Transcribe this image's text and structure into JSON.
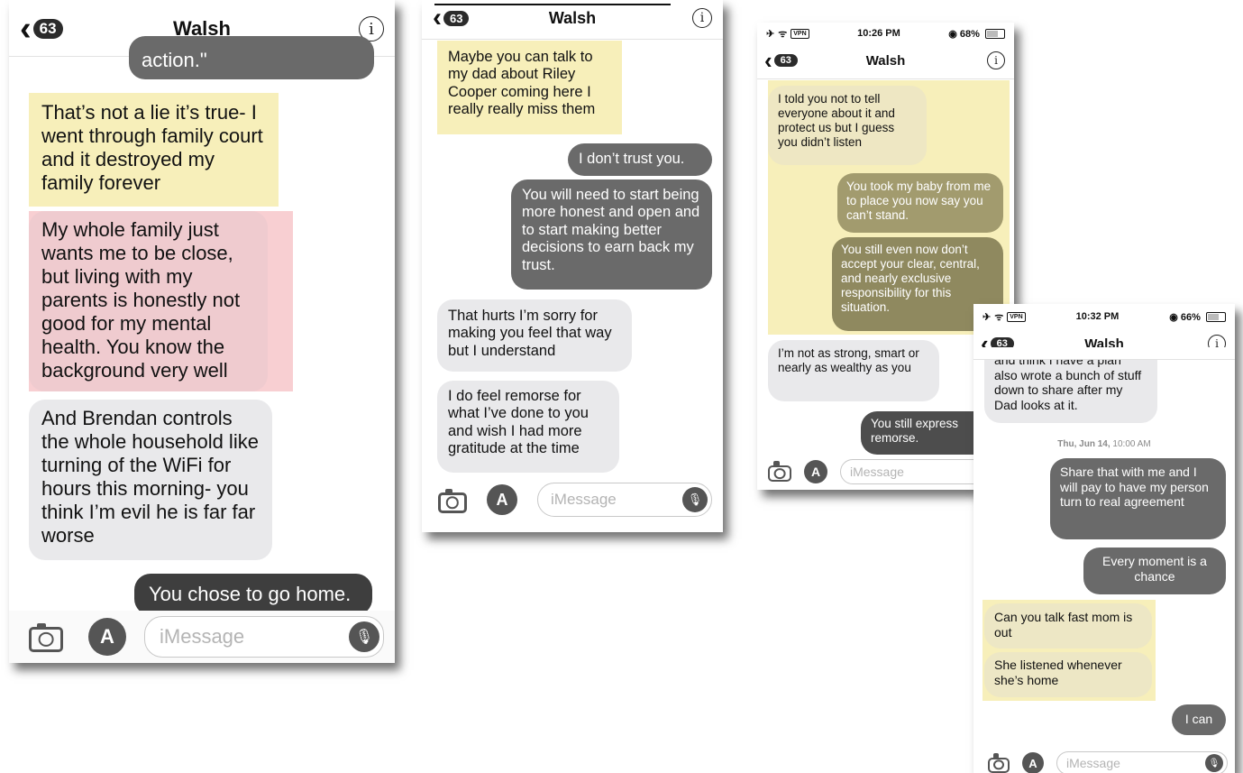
{
  "screens": [
    {
      "contact": "Walsh",
      "unread_count": "63",
      "messages": [
        {
          "dir": "out",
          "text": "action.\""
        },
        {
          "dir": "in",
          "text": "That’s not a lie it’s true- I went through family court and it destroyed my family forever"
        },
        {
          "dir": "in",
          "text": "My whole family just wants me to be close, but living with my parents is honestly not good for my mental health. You know the background very well"
        },
        {
          "dir": "in",
          "text": "And Brendan controls the whole household like turning of the WiFi for hours this morning- you think I’m evil he is far far worse"
        },
        {
          "dir": "out",
          "text": "You chose to go home."
        }
      ],
      "input_placeholder": "iMessage"
    },
    {
      "contact": "Walsh",
      "unread_count": "63",
      "messages": [
        {
          "dir": "in",
          "text": "Maybe you can talk to my dad about Riley Cooper coming here I really really miss them"
        },
        {
          "dir": "out",
          "text": "I don’t trust you."
        },
        {
          "dir": "out",
          "text": "You will need to start being more honest and open and to start making better decisions to earn back my trust."
        },
        {
          "dir": "in",
          "text": "That hurts I’m sorry for making you feel that way but I understand"
        },
        {
          "dir": "in",
          "text": "I do feel remorse for what I’ve done to you and wish I had more gratitude at the time"
        }
      ],
      "input_placeholder": "iMessage"
    },
    {
      "status_time": "10:26 PM",
      "status_battery": "68%",
      "contact": "Walsh",
      "unread_count": "63",
      "messages": [
        {
          "dir": "in",
          "text": "I told you not to tell everyone about it and protect us but I guess you didn’t listen"
        },
        {
          "dir": "out",
          "text": "You took my baby from me to place you now say you can’t stand."
        },
        {
          "dir": "out",
          "text": "You still even now don’t accept your clear, central, and nearly exclusive responsibility for this situation."
        },
        {
          "dir": "in",
          "text": "I’m not as strong, smart or nearly as wealthy as you"
        },
        {
          "dir": "out",
          "text": "You still express remorse."
        }
      ],
      "input_placeholder": "iMessage"
    },
    {
      "status_time": "10:32 PM",
      "status_battery": "66%",
      "contact": "Walsh",
      "unread_count": "63",
      "timestamp_day": "Thu, Jun 14,",
      "timestamp_time": "10:00 AM",
      "messages": [
        {
          "dir": "in",
          "text": "and think I have a plan also wrote a bunch of stuff down to share after my Dad looks at it."
        },
        {
          "dir": "out",
          "text": "Share that with me and I will pay to have my person turn to real agreement"
        },
        {
          "dir": "out",
          "text": "Every moment is a chance"
        },
        {
          "dir": "in",
          "text": "Can you talk fast mom is out"
        },
        {
          "dir": "in",
          "text": "She listened whenever she’s home"
        },
        {
          "dir": "out",
          "text": "I can"
        }
      ],
      "input_placeholder": "iMessage"
    }
  ],
  "icons": {
    "back": "‹",
    "info": "i",
    "airplane": "✈",
    "wifi": "ᯤ",
    "vpn": "VPN",
    "location": "◉",
    "appstore": "A",
    "mic": "🎙"
  },
  "colors": {
    "incoming_bubble": "#e9e9eb",
    "outgoing_bubble": "#6a6a6a",
    "highlight_yellow": "#f7efba",
    "highlight_red": "#f8cfd2"
  }
}
